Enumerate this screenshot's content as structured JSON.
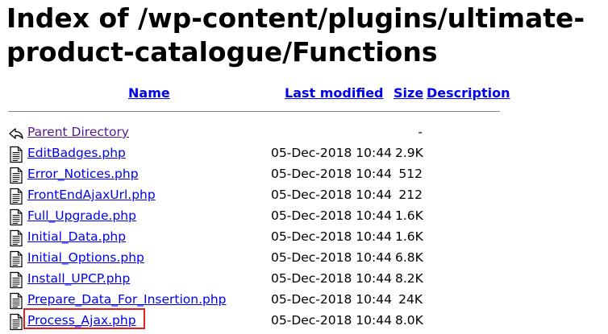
{
  "title": "Index of /wp-content/plugins/ultimate-product-catalogue/Functions",
  "columns": {
    "name": "Name",
    "modified": "Last modified",
    "size": "Size",
    "description": "Description"
  },
  "parent": {
    "name": "Parent Directory",
    "size": "-"
  },
  "files": [
    {
      "name": "EditBadges.php",
      "modified": "05-Dec-2018 10:44",
      "size": "2.9K"
    },
    {
      "name": "Error_Notices.php",
      "modified": "05-Dec-2018 10:44",
      "size": "512"
    },
    {
      "name": "FrontEndAjaxUrl.php",
      "modified": "05-Dec-2018 10:44",
      "size": "212"
    },
    {
      "name": "Full_Upgrade.php",
      "modified": "05-Dec-2018 10:44",
      "size": "1.6K"
    },
    {
      "name": "Initial_Data.php",
      "modified": "05-Dec-2018 10:44",
      "size": "1.6K"
    },
    {
      "name": "Initial_Options.php",
      "modified": "05-Dec-2018 10:44",
      "size": "6.8K"
    },
    {
      "name": "Install_UPCP.php",
      "modified": "05-Dec-2018 10:44",
      "size": "8.2K"
    },
    {
      "name": "Prepare_Data_For_Insertion.php",
      "modified": "05-Dec-2018 10:44",
      "size": "24K"
    },
    {
      "name": "Process_Ajax.php",
      "modified": "05-Dec-2018 10:44",
      "size": "8.0K"
    }
  ],
  "colors": {
    "link": "#0000ee",
    "visited": "#551a8b",
    "highlight": "#e02020"
  }
}
